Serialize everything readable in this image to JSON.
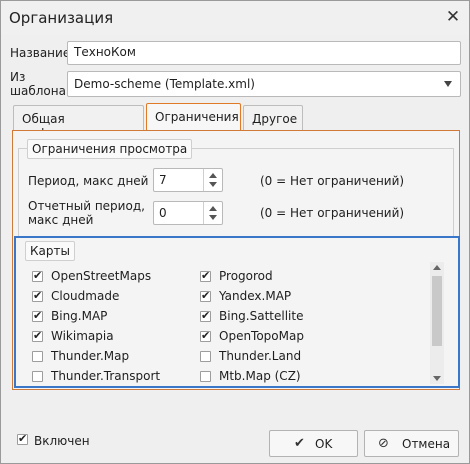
{
  "dialog": {
    "title": "Организация",
    "close_glyph": "✕"
  },
  "form": {
    "name_label": "Название",
    "name_value": "ТехноКом",
    "template_label_1": "Из",
    "template_label_2": "шаблона",
    "template_value": "Demo-scheme (Template.xml)"
  },
  "tabs": [
    {
      "label": "Общая информация"
    },
    {
      "label": "Ограничения"
    },
    {
      "label": "Другое"
    }
  ],
  "restrictions": {
    "legend": "Ограничения просмотра",
    "period_label": "Период, макс дней",
    "period_value": "7",
    "period_hint": "(0 = Нет ограничений)",
    "report_label_1": "Отчетный период,",
    "report_label_2": "макс дней",
    "report_value": "0",
    "report_hint": "(0 = Нет ограничений)"
  },
  "maps": {
    "legend": "Карты",
    "items": [
      {
        "label": "OpenStreetMaps",
        "checked": true
      },
      {
        "label": "Progorod",
        "checked": true
      },
      {
        "label": "Cloudmade",
        "checked": true
      },
      {
        "label": "Yandex.MAP",
        "checked": true
      },
      {
        "label": "Bing.MAP",
        "checked": true
      },
      {
        "label": "Bing.Sattellite",
        "checked": true
      },
      {
        "label": "Wikimapia",
        "checked": true
      },
      {
        "label": "OpenTopoMap",
        "checked": true
      },
      {
        "label": "Thunder.Map",
        "checked": false
      },
      {
        "label": "Thunder.Land",
        "checked": false
      },
      {
        "label": "Thunder.Transport",
        "checked": false
      },
      {
        "label": "Mtb.Map (CZ)",
        "checked": false
      }
    ]
  },
  "footer": {
    "enabled_label": "Включен",
    "enabled_checked": true,
    "ok_label": "OK",
    "cancel_label": "Отмена"
  },
  "colors": {
    "active_tab_border": "#e07a26",
    "maps_border": "#3a77c8"
  }
}
